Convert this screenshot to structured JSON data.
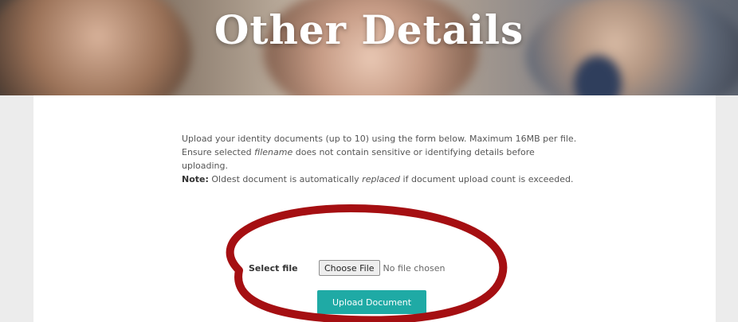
{
  "banner": {
    "title": "Other Details"
  },
  "info": {
    "line1": "Upload your identity documents (up to 10) using the form below. Maximum 16MB per file.",
    "line2_pre": "Ensure selected ",
    "line2_em": "filename",
    "line2_post": " does not contain sensitive or identifying details before uploading.",
    "note_label": "Note:",
    "note_pre": " Oldest document is automatically ",
    "note_em": "replaced",
    "note_post": " if document upload count is exceeded."
  },
  "file_input": {
    "label": "Select file",
    "choose_label": "Choose File",
    "status": "No file chosen"
  },
  "upload_button": {
    "label": "Upload Document"
  },
  "colors": {
    "accent": "#1faaa5",
    "annotation": "#a50f12",
    "gutter": "#ececec"
  }
}
